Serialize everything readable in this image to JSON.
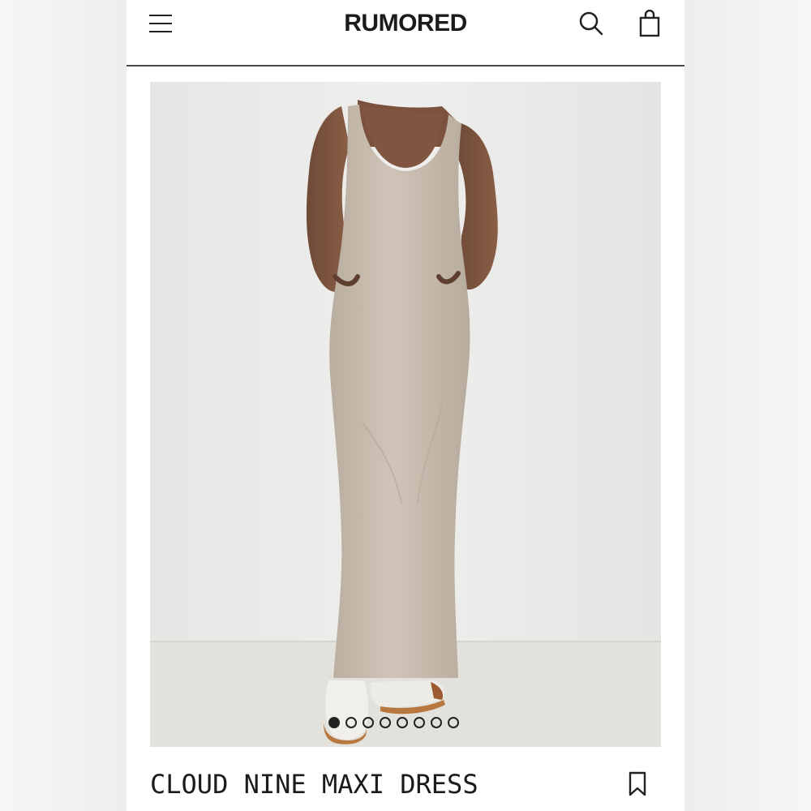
{
  "header": {
    "brand": "RUMORED",
    "menu_icon": "hamburger-menu-icon",
    "search_icon": "search-icon",
    "bag_icon": "shopping-bag-icon"
  },
  "gallery": {
    "image_description": "model in beige sleeveless maxi dress",
    "slide_count": 8,
    "active_slide": 1
  },
  "product": {
    "title": "CLOUD NINE MAXI DRESS",
    "bookmark_icon": "bookmark-icon"
  },
  "colors": {
    "text": "#1b1b1b",
    "dress": "#c8bdaf",
    "backdrop": "#e9e9e7",
    "floor": "#e4e2dd"
  }
}
